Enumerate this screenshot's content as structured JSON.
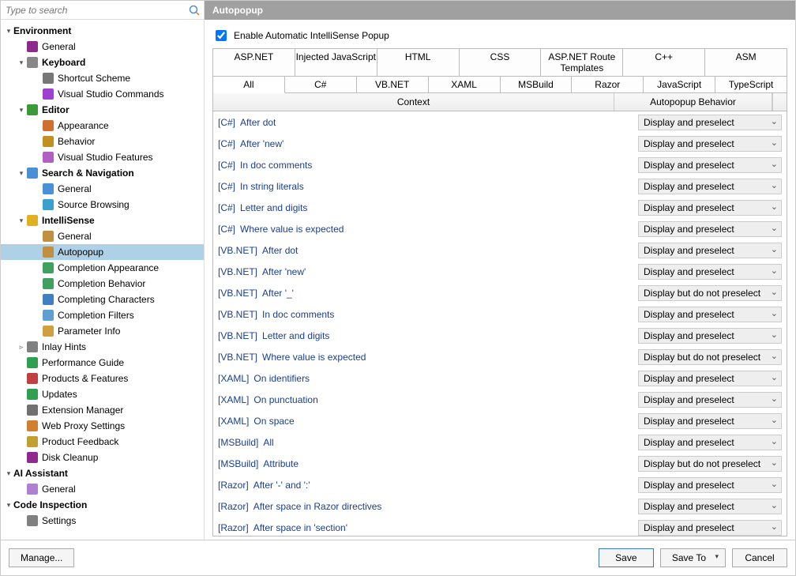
{
  "search": {
    "placeholder": "Type to search"
  },
  "title": "Autopopup",
  "enable_checkbox": {
    "label": "Enable Automatic IntelliSense Popup",
    "checked": true
  },
  "tabs_row1": [
    "ASP.NET",
    "Injected JavaScript",
    "HTML",
    "CSS",
    "ASP.NET Route Templates",
    "C++",
    "ASM"
  ],
  "tabs_row2": [
    "All",
    "C#",
    "VB.NET",
    "XAML",
    "MSBuild",
    "Razor",
    "JavaScript",
    "TypeScript"
  ],
  "active_tab": "All",
  "grid": {
    "headers": {
      "context": "Context",
      "behavior": "Autopopup Behavior"
    },
    "rows": [
      {
        "lang": "[C#]",
        "desc": "After dot",
        "behavior": "Display and preselect"
      },
      {
        "lang": "[C#]",
        "desc": "After 'new'",
        "behavior": "Display and preselect"
      },
      {
        "lang": "[C#]",
        "desc": "In doc comments",
        "behavior": "Display and preselect"
      },
      {
        "lang": "[C#]",
        "desc": "In string literals",
        "behavior": "Display and preselect"
      },
      {
        "lang": "[C#]",
        "desc": "Letter and digits",
        "behavior": "Display and preselect"
      },
      {
        "lang": "[C#]",
        "desc": "Where value is expected",
        "behavior": "Display and preselect"
      },
      {
        "lang": "[VB.NET]",
        "desc": "After dot",
        "behavior": "Display and preselect"
      },
      {
        "lang": "[VB.NET]",
        "desc": "After 'new'",
        "behavior": "Display and preselect"
      },
      {
        "lang": "[VB.NET]",
        "desc": "After '_'",
        "behavior": "Display but do not preselect"
      },
      {
        "lang": "[VB.NET]",
        "desc": "In doc comments",
        "behavior": "Display and preselect"
      },
      {
        "lang": "[VB.NET]",
        "desc": "Letter and digits",
        "behavior": "Display and preselect"
      },
      {
        "lang": "[VB.NET]",
        "desc": "Where value is expected",
        "behavior": "Display but do not preselect"
      },
      {
        "lang": "[XAML]",
        "desc": "On identifiers",
        "behavior": "Display and preselect"
      },
      {
        "lang": "[XAML]",
        "desc": "On punctuation",
        "behavior": "Display and preselect"
      },
      {
        "lang": "[XAML]",
        "desc": "On space",
        "behavior": "Display and preselect"
      },
      {
        "lang": "[MSBuild]",
        "desc": "All",
        "behavior": "Display and preselect"
      },
      {
        "lang": "[MSBuild]",
        "desc": "Attribute",
        "behavior": "Display but do not preselect"
      },
      {
        "lang": "[Razor]",
        "desc": "After '-' and ':'",
        "behavior": "Display and preselect"
      },
      {
        "lang": "[Razor]",
        "desc": "After space in Razor directives",
        "behavior": "Display and preselect"
      },
      {
        "lang": "[Razor]",
        "desc": "After space in 'section'",
        "behavior": "Display and preselect"
      }
    ]
  },
  "tree": [
    {
      "lvl": 0,
      "arrow": "▾",
      "bold": true,
      "label": "Environment",
      "icon": ""
    },
    {
      "lvl": 1,
      "arrow": "",
      "label": "General",
      "icon": "rs"
    },
    {
      "lvl": 1,
      "arrow": "▾",
      "bold": true,
      "label": "Keyboard",
      "icon": "kb"
    },
    {
      "lvl": 2,
      "arrow": "",
      "label": "Shortcut Scheme",
      "icon": "wrench"
    },
    {
      "lvl": 2,
      "arrow": "",
      "label": "Visual Studio Commands",
      "icon": "vs"
    },
    {
      "lvl": 1,
      "arrow": "▾",
      "bold": true,
      "label": "Editor",
      "icon": "pencil"
    },
    {
      "lvl": 2,
      "arrow": "",
      "label": "Appearance",
      "icon": "palette"
    },
    {
      "lvl": 2,
      "arrow": "",
      "label": "Behavior",
      "icon": "gear"
    },
    {
      "lvl": 2,
      "arrow": "",
      "label": "Visual Studio Features",
      "icon": "vs2"
    },
    {
      "lvl": 1,
      "arrow": "▾",
      "bold": true,
      "label": "Search & Navigation",
      "icon": "search"
    },
    {
      "lvl": 2,
      "arrow": "",
      "label": "General",
      "icon": "search2"
    },
    {
      "lvl": 2,
      "arrow": "",
      "label": "Source Browsing",
      "icon": "globe"
    },
    {
      "lvl": 1,
      "arrow": "▾",
      "bold": true,
      "label": "IntelliSense",
      "icon": "bulb"
    },
    {
      "lvl": 2,
      "arrow": "",
      "label": "General",
      "icon": "ilist"
    },
    {
      "lvl": 2,
      "arrow": "",
      "label": "Autopopup",
      "icon": "popup",
      "selected": true
    },
    {
      "lvl": 2,
      "arrow": "",
      "label": "Completion Appearance",
      "icon": "cap"
    },
    {
      "lvl": 2,
      "arrow": "",
      "label": "Completion Behavior",
      "icon": "cbe"
    },
    {
      "lvl": 2,
      "arrow": "",
      "label": "Completing Characters",
      "icon": "cch"
    },
    {
      "lvl": 2,
      "arrow": "",
      "label": "Completion Filters",
      "icon": "filter"
    },
    {
      "lvl": 2,
      "arrow": "",
      "label": "Parameter Info",
      "icon": "pinfo"
    },
    {
      "lvl": 1,
      "arrow": "▹",
      "label": "Inlay Hints",
      "icon": "hint"
    },
    {
      "lvl": 1,
      "arrow": "",
      "label": "Performance Guide",
      "icon": "perf"
    },
    {
      "lvl": 1,
      "arrow": "",
      "label": "Products & Features",
      "icon": "prod"
    },
    {
      "lvl": 1,
      "arrow": "",
      "label": "Updates",
      "icon": "upd"
    },
    {
      "lvl": 1,
      "arrow": "",
      "label": "Extension Manager",
      "icon": "ext"
    },
    {
      "lvl": 1,
      "arrow": "",
      "label": "Web Proxy Settings",
      "icon": "proxy"
    },
    {
      "lvl": 1,
      "arrow": "",
      "label": "Product Feedback",
      "icon": "fb"
    },
    {
      "lvl": 1,
      "arrow": "",
      "label": "Disk Cleanup",
      "icon": "disk"
    },
    {
      "lvl": 0,
      "arrow": "▾",
      "bold": true,
      "label": "AI Assistant",
      "icon": ""
    },
    {
      "lvl": 1,
      "arrow": "",
      "label": "General",
      "icon": "ai"
    },
    {
      "lvl": 0,
      "arrow": "▾",
      "bold": true,
      "label": "Code Inspection",
      "icon": ""
    },
    {
      "lvl": 1,
      "arrow": "",
      "label": "Settings",
      "icon": "cis"
    }
  ],
  "footer": {
    "manage": "Manage...",
    "save": "Save",
    "save_to": "Save To",
    "cancel": "Cancel"
  },
  "icon_colors": {
    "rs": "#8e2a8e",
    "kb": "#888",
    "wrench": "#777",
    "vs": "#a040d0",
    "pencil": "#3a9a3a",
    "palette": "#d07030",
    "gear": "#c09020",
    "vs2": "#b060c0",
    "search": "#4a90d9",
    "search2": "#4a90d9",
    "globe": "#3aa0d0",
    "bulb": "#e0b020",
    "ilist": "#c09040",
    "popup": "#c09040",
    "cap": "#40a060",
    "cbe": "#40a060",
    "cch": "#4080c0",
    "filter": "#60a0d0",
    "pinfo": "#d0a040",
    "hint": "#808080",
    "perf": "#30a050",
    "prod": "#c04040",
    "upd": "#30a050",
    "ext": "#707070",
    "proxy": "#d08030",
    "fb": "#c0a030",
    "disk": "#8e2a8e",
    "ai": "#b080d0",
    "cis": "#808080"
  }
}
